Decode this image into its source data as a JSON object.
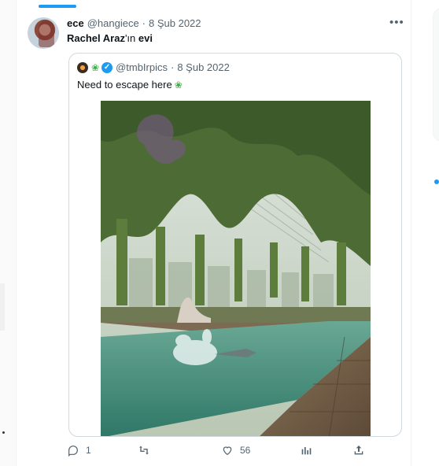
{
  "tweet": {
    "display_name": "ece",
    "handle": "@hangiece",
    "separator": "·",
    "date": "8 Şub 2022",
    "more_icon": "more-horizontal-icon",
    "text_bold": "Rachel Araz",
    "text_plain": "'ın",
    "text_bold_end": "evi"
  },
  "quote": {
    "leaf_emoji": "leaf-icon",
    "verified_icon": "verified-badge-icon",
    "handle": "@tmbIrpics",
    "separator": "·",
    "date": "8 Şub 2022",
    "text": "Need to escape here",
    "media_description_icon": "photo"
  },
  "actions": {
    "reply": {
      "icon": "reply-icon",
      "count": "1"
    },
    "retweet": {
      "icon": "retweet-icon",
      "count": ""
    },
    "like": {
      "icon": "heart-icon",
      "count": "56"
    },
    "views": {
      "icon": "analytics-icon",
      "count": ""
    },
    "share": {
      "icon": "share-icon",
      "count": ""
    }
  },
  "colors": {
    "accent": "#1d9bf0",
    "muted_text": "#536471",
    "border": "#cfd9de",
    "pool_green": "#4f9a84"
  }
}
